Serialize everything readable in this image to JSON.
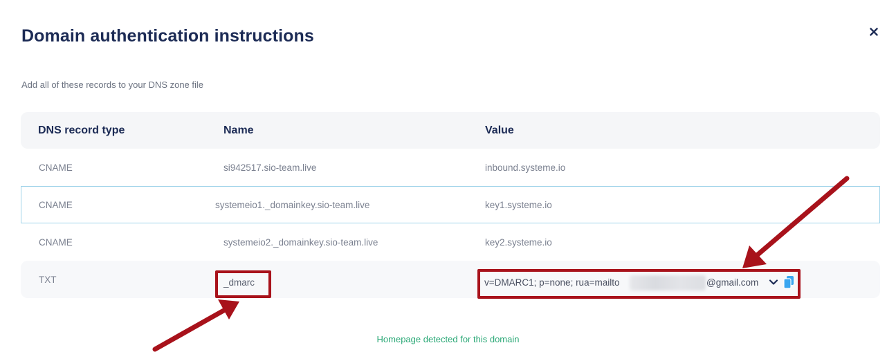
{
  "dialog": {
    "title": "Domain authentication instructions",
    "subtitle": "Add all of these records to your DNS zone file",
    "close_icon": "close-icon"
  },
  "table": {
    "headers": [
      "DNS record type",
      "Name",
      "Value"
    ],
    "rows": [
      {
        "type": "CNAME",
        "name": "si942517.sio-team.live",
        "value": "inbound.systeme.io"
      },
      {
        "type": "CNAME",
        "name": "systemeio1._domainkey.sio-team.live",
        "value": "key1.systeme.io"
      },
      {
        "type": "CNAME",
        "name": "systemeio2._domainkey.sio-team.live",
        "value": "key2.systeme.io"
      },
      {
        "type": "TXT",
        "name": "_dmarc",
        "value_prefix": "v=DMARC1; p=none; rua=mailto",
        "value_suffix": "@gmail.com"
      }
    ]
  },
  "footer": {
    "status": "Homepage detected for this domain"
  },
  "colors": {
    "title": "#1c2b55",
    "annotation_red": "#a8121b",
    "success_green": "#2aa876",
    "selected_border": "#9fd3ea"
  }
}
